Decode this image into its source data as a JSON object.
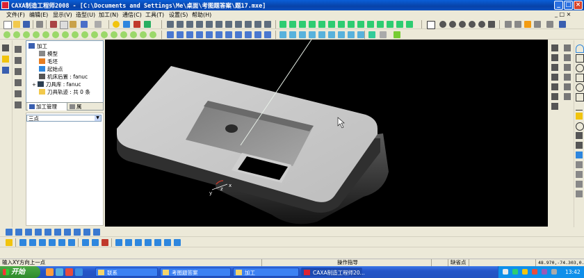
{
  "window": {
    "title": "CAXA制造工程师2008 - [C:\\Documents and Settings\\Me\\桌面\\考图题答案\\题17.mxe]"
  },
  "menu": {
    "items": [
      "文件(F)",
      "编辑(E)",
      "显示(V)",
      "造型(U)",
      "加工(N)",
      "通信(C)",
      "工具(T)",
      "设置(S)",
      "帮助(H)"
    ]
  },
  "tree": {
    "root": "加工",
    "items": [
      "模型",
      "毛坯",
      "起始点",
      "机床后置 : fanuc",
      "刀具库 : fanuc",
      "刀具轨迹 : 共 0 条"
    ]
  },
  "tree_tabs": {
    "tab1": "加工管理",
    "tab2": "属"
  },
  "side_combo": {
    "value": "三点"
  },
  "viewport": {
    "axis_x": "x",
    "axis_y": "y",
    "axis_z": "z"
  },
  "command": {
    "prompt": "输入XY方向上一点"
  },
  "statusbar": {
    "hint": "操作指导",
    "mode": "缺省点",
    "coords": "48.970,-74.303,0.000"
  },
  "taskbar": {
    "start": "开始",
    "tasks": [
      "联系",
      "考图题答案",
      "加工",
      "CAXA制造工程师20..."
    ],
    "clock": "13:42"
  },
  "colors": {
    "title_bar": "#0a4fbf",
    "viewport_bg": "#000000",
    "taskbar": "#2455c8"
  }
}
